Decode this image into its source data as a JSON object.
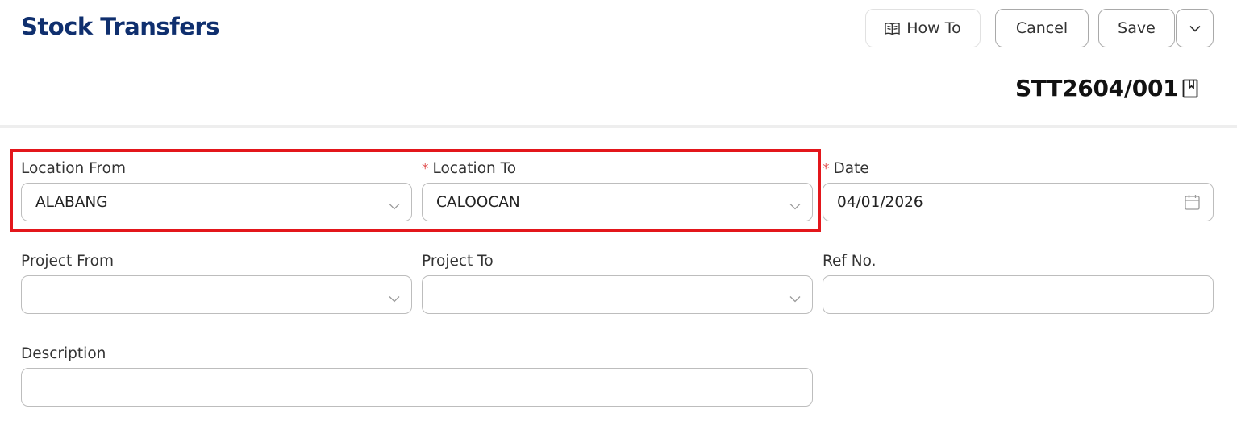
{
  "header": {
    "title": "Stock Transfers",
    "doc_number": "STT2604/001"
  },
  "toolbar": {
    "how_to_label": "How To",
    "cancel_label": "Cancel",
    "save_label": "Save"
  },
  "form": {
    "location_from": {
      "label": "Location From",
      "value": "ALABANG",
      "required": false
    },
    "location_to": {
      "label": "Location To",
      "value": "CALOOCAN",
      "required": true
    },
    "date": {
      "label": "Date",
      "value": "04/01/2026",
      "required": true
    },
    "project_from": {
      "label": "Project From",
      "value": ""
    },
    "project_to": {
      "label": "Project To",
      "value": ""
    },
    "ref_no": {
      "label": "Ref No.",
      "value": ""
    },
    "description": {
      "label": "Description",
      "value": ""
    },
    "required_marker": "*"
  },
  "icons": {
    "how_to": "book-icon",
    "more": "chevron-down-icon",
    "doc": "bookmark-icon",
    "select": "chevron-down-icon",
    "date": "calendar-icon"
  },
  "colors": {
    "title": "#0f2f6e",
    "highlight": "#e3161b",
    "required": "#e25555"
  }
}
